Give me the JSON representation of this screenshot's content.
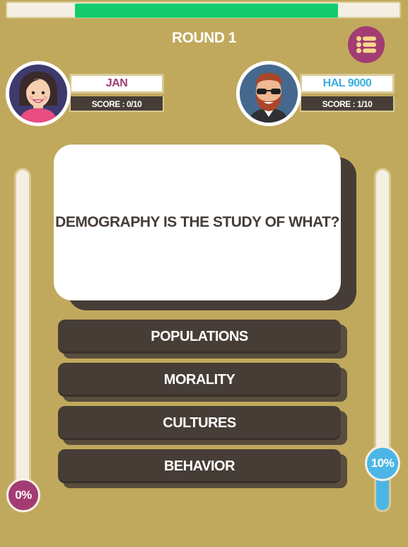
{
  "timer": {
    "fraction_remaining": 0.67
  },
  "header": {
    "round_label": "ROUND 1"
  },
  "menu": {
    "icon": "list-icon"
  },
  "players": [
    {
      "name": "JAN",
      "score_label": "SCORE : 0/10",
      "name_color": "#a23c73",
      "avatar": "woman-avatar"
    },
    {
      "name": "HAL 9000",
      "score_label": "SCORE : 1/10",
      "name_color": "#3eaee0",
      "avatar": "bearded-man-avatar"
    }
  ],
  "question": {
    "text": "DEMOGRAPHY IS THE STUDY OF WHAT?"
  },
  "answers": [
    {
      "label": "POPULATIONS"
    },
    {
      "label": "MORALITY"
    },
    {
      "label": "CULTURES"
    },
    {
      "label": "BEHAVIOR"
    }
  ],
  "meters": {
    "left": {
      "label": "0%",
      "percent": 0,
      "color": "#a23c73"
    },
    "right": {
      "label": "10%",
      "percent": 10,
      "color": "#4bb6e6"
    }
  },
  "colors": {
    "background": "#c0a95c",
    "timer_fill": "#12cc6e",
    "answer_bg": "#463d37"
  }
}
